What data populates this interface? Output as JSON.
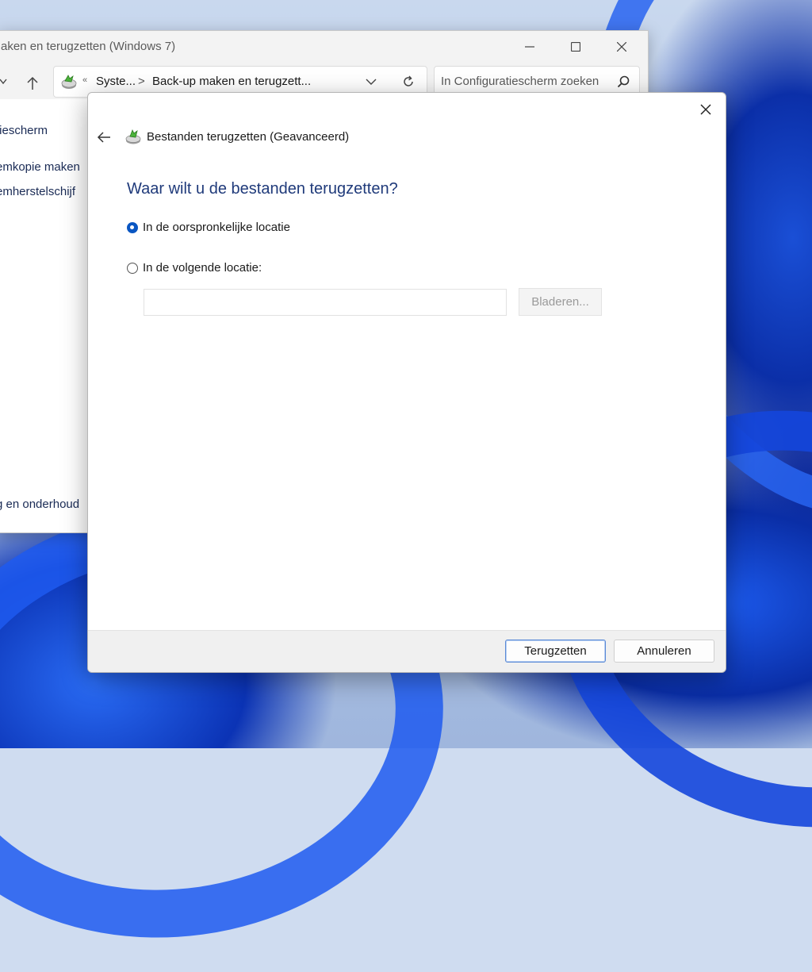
{
  "background_window": {
    "title": "aken en terugzetten (Windows 7)",
    "breadcrumb": {
      "overflow": "«",
      "segment1": "Syste...",
      "separator": ">",
      "segment2": "Back-up maken en terugzett..."
    },
    "search_placeholder": "In Configuratiescherm zoeken",
    "sidebar_links": [
      "tiescherm",
      "emkopie maken",
      "emherstelschijf",
      "g en onderhoud"
    ]
  },
  "dialog": {
    "title": "Bestanden terugzetten (Geavanceerd)",
    "question": "Waar wilt u de bestanden terugzetten?",
    "options": [
      {
        "label": "In de oorspronkelijke locatie",
        "checked": true
      },
      {
        "label": "In de volgende locatie:",
        "checked": false
      }
    ],
    "location_value": "",
    "browse_label": "Bladeren...",
    "restore_label": "Terugzetten",
    "cancel_label": "Annuleren"
  },
  "colors": {
    "accent": "#0a56c2",
    "question_text": "#1f3a7a",
    "footer_bg": "#f0f0f0"
  }
}
